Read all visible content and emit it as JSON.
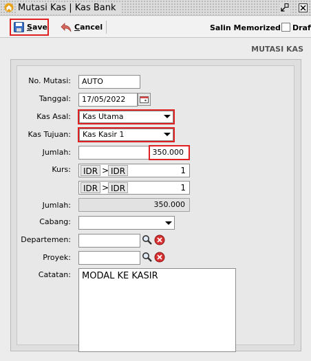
{
  "window": {
    "title": "Mutasi Kas | Kas Bank",
    "icon": "app-chevron-icon",
    "accent": "#e8a21c"
  },
  "toolbar": {
    "save_label": "Save",
    "save_key": "S",
    "save_rest": "ave",
    "cancel_label": "Cancel",
    "cancel_key": "C",
    "cancel_rest": "ancel",
    "salin_label": "Salin Memorized",
    "draft_label": "Draft",
    "draft_checked": false
  },
  "section_title": "MUTASI KAS",
  "form": {
    "no_mutasi": {
      "label": "No. Mutasi:",
      "value": "AUTO"
    },
    "tanggal": {
      "label": "Tanggal:",
      "value": "17/05/2022"
    },
    "kas_asal": {
      "label": "Kas Asal:",
      "value": "Kas Utama"
    },
    "kas_tujuan": {
      "label": "Kas Tujuan:",
      "value": "Kas Kasir 1"
    },
    "jumlah": {
      "label": "Jumlah:",
      "value": "350.000"
    },
    "kurs": {
      "label": "Kurs:",
      "rows": [
        {
          "from": "IDR",
          "sep": ">",
          "to": "IDR",
          "rate": "1"
        },
        {
          "from": "IDR",
          "sep": ">",
          "to": "IDR",
          "rate": "1"
        }
      ]
    },
    "jumlah2": {
      "label": "Jumlah:",
      "value": "350.000"
    },
    "cabang": {
      "label": "Cabang:",
      "value": ""
    },
    "departemen": {
      "label": "Departemen:",
      "value": ""
    },
    "proyek": {
      "label": "Proyek:",
      "value": ""
    },
    "catatan": {
      "label": "Catatan:",
      "value": "MODAL KE KASIR"
    }
  },
  "colors": {
    "highlight": "#e02020",
    "panel": "#e8e8e8",
    "clear_icon": "#d83030"
  }
}
